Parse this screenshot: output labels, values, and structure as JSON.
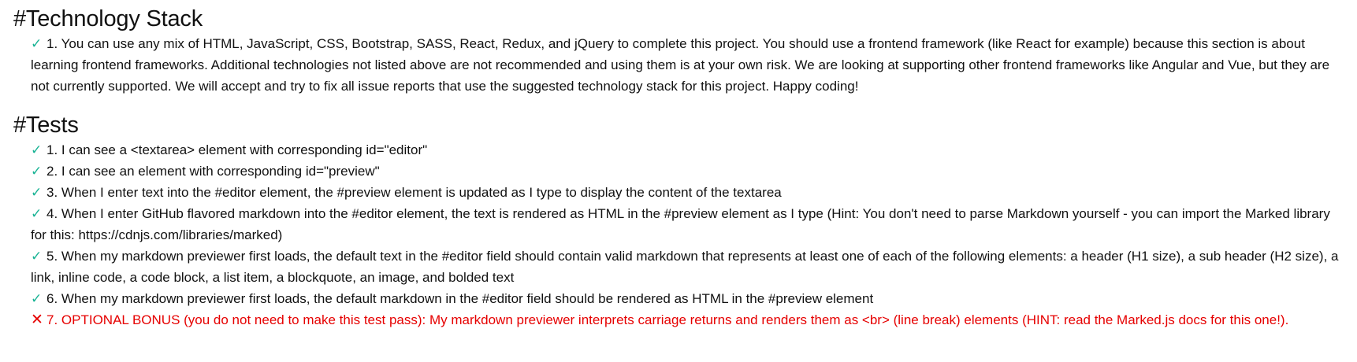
{
  "sections": {
    "tech": {
      "title": "#Technology Stack",
      "items": [
        {
          "status": "pass",
          "mark": "✓",
          "text": "1. You can use any mix of HTML, JavaScript, CSS, Bootstrap, SASS, React, Redux, and jQuery to complete this project. You should use a frontend framework (like React for example) because this section is about learning frontend frameworks. Additional technologies not listed above are not recommended and using them is at your own risk. We are looking at supporting other frontend frameworks like Angular and Vue, but they are not currently supported. We will accept and try to fix all issue reports that use the suggested technology stack for this project. Happy coding!"
        }
      ]
    },
    "tests": {
      "title": "#Tests",
      "items": [
        {
          "status": "pass",
          "mark": "✓",
          "text": "1. I can see a <textarea> element with corresponding id=\"editor\""
        },
        {
          "status": "pass",
          "mark": "✓",
          "text": "2. I can see an element with corresponding id=\"preview\""
        },
        {
          "status": "pass",
          "mark": "✓",
          "text": "3. When I enter text into the #editor element, the #preview element is updated as I type to display the content of the textarea"
        },
        {
          "status": "pass",
          "mark": "✓",
          "text": "4. When I enter GitHub flavored markdown into the #editor element, the text is rendered as HTML in the #preview element as I type (Hint: You don't need to parse Markdown yourself - you can import the Marked library for this: https://cdnjs.com/libraries/marked)"
        },
        {
          "status": "pass",
          "mark": "✓",
          "text": "5. When my markdown previewer first loads, the default text in the #editor field should contain valid markdown that represents at least one of each of the following elements: a header (H1 size), a sub header (H2 size), a link, inline code, a code block, a list item, a blockquote, an image, and bolded text"
        },
        {
          "status": "pass",
          "mark": "✓",
          "text": "6. When my markdown previewer first loads, the default markdown in the #editor field should be rendered as HTML in the #preview element"
        },
        {
          "status": "fail",
          "mark": "✕",
          "text": "7. OPTIONAL BONUS (you do not need to make this test pass): My markdown previewer interprets carriage returns and renders them as <br> (line break) elements (HINT: read the Marked.js docs for this one!)."
        }
      ]
    }
  },
  "colors": {
    "pass": "#18b394",
    "fail": "#e60000",
    "text": "#111111",
    "background": "#ffffff"
  },
  "icons": {
    "pass": "check-icon",
    "fail": "cross-icon"
  }
}
